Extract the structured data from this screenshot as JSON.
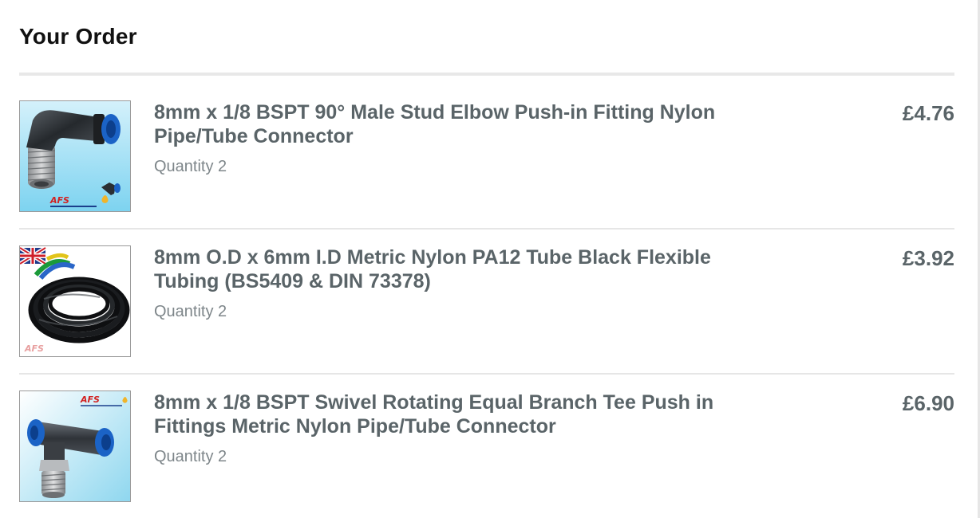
{
  "order": {
    "title": "Your Order",
    "items": [
      {
        "name": "8mm x 1/8 BSPT 90° Male Stud Elbow Push-in Fitting Nylon Pipe/Tube Connector",
        "quantity": "Quantity 2",
        "price": "£4.76",
        "image_icon": "elbow-fitting-product-image",
        "image_text": "AFS"
      },
      {
        "name": "8mm O.D x 6mm I.D Metric Nylon PA12 Tube Black Flexible Tubing (BS5409 & DIN 73378)",
        "quantity": "Quantity 2",
        "price": "£3.92",
        "image_icon": "nylon-tubing-coil-product-image",
        "image_text": "AFS"
      },
      {
        "name": "8mm x 1/8 BSPT Swivel Rotating Equal Branch Tee Push in Fittings Metric Nylon Pipe/Tube Connector",
        "quantity": "Quantity 2",
        "price": "£6.90",
        "image_icon": "branch-tee-fitting-product-image",
        "image_text": "AFS"
      }
    ]
  },
  "colors": {
    "title": "#111111",
    "item_text": "#5a6468",
    "quantity_text": "#7e868a",
    "divider": "#e6e6e6",
    "fitting_blue": "#1b63c6"
  }
}
